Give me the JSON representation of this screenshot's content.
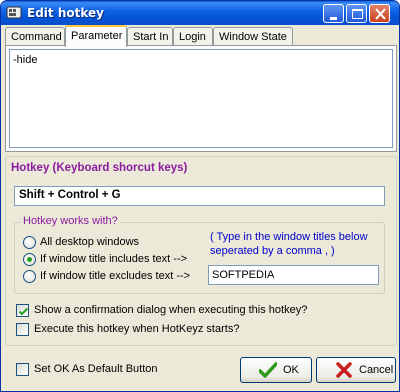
{
  "window": {
    "title": "Edit hotkey"
  },
  "tabs": [
    {
      "label": "Command"
    },
    {
      "label": "Parameter"
    },
    {
      "label": "Start In"
    },
    {
      "label": "Login"
    },
    {
      "label": "Window State"
    }
  ],
  "active_tab": "Parameter",
  "parameter": {
    "value": "-hide"
  },
  "hotkey": {
    "legend": "Hotkey (Keyboard shorcut keys)",
    "value": "Shift + Control + G"
  },
  "works_with": {
    "legend": "Hotkey works with?",
    "options": [
      {
        "label": "All desktop windows",
        "selected": false
      },
      {
        "label": "If window title includes text -->",
        "selected": true
      },
      {
        "label": "If window title excludes text -->",
        "selected": false
      }
    ],
    "hint": "( Type in the window titles below seperated by a comma , )",
    "titles_value": "SOFTPEDIA"
  },
  "options": {
    "confirm_label": "Show a confirmation dialog when executing this hotkey?",
    "confirm_checked": true,
    "startup_label": "Execute this hotkey when HotKeyz starts?",
    "startup_checked": false,
    "default_ok_label": "Set OK As Default Button",
    "default_ok_checked": false
  },
  "buttons": {
    "ok": "OK",
    "cancel": "Cancel"
  },
  "colors": {
    "legend": "#8b1ba0",
    "hint": "#0000cc",
    "ok_check": "#2e9b1c",
    "cancel_x": "#c81e1e"
  }
}
